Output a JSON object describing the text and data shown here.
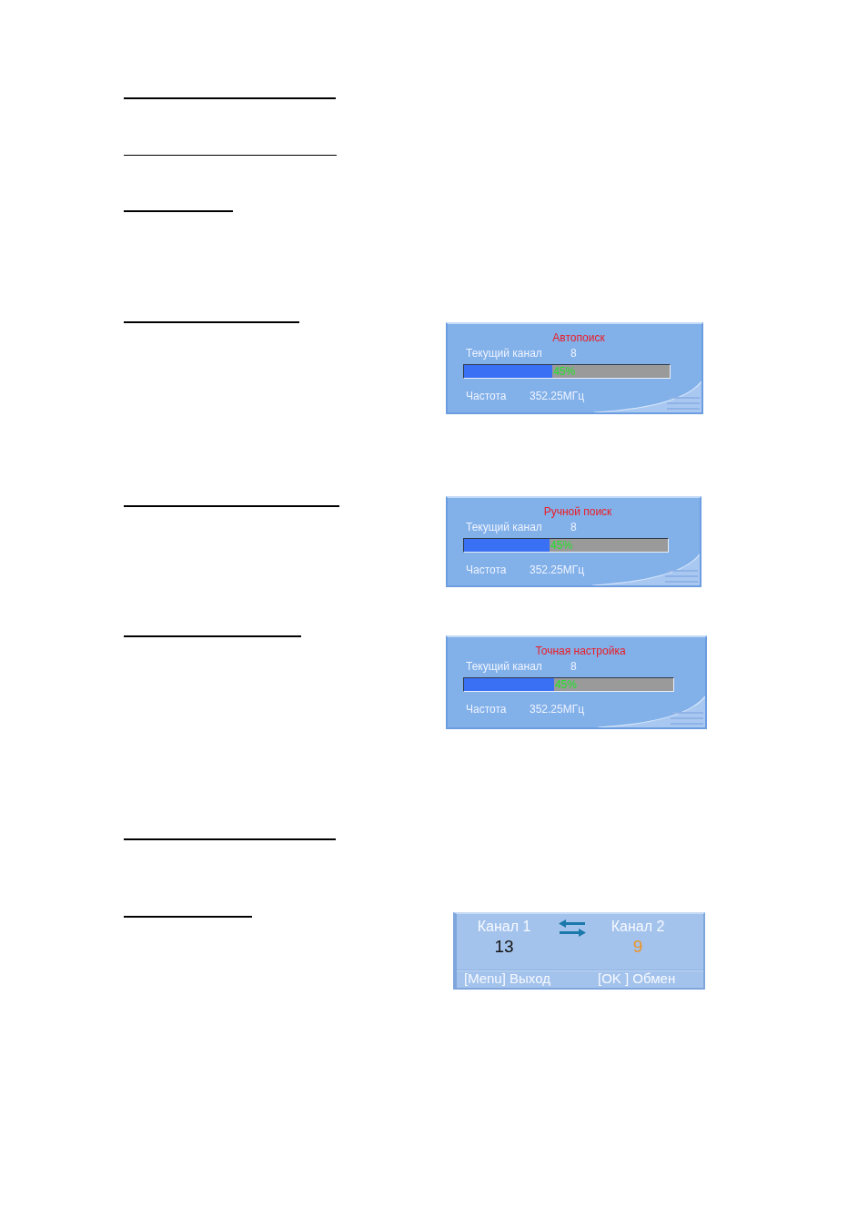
{
  "osd_screens": [
    {
      "kind": "search",
      "title": "Автопоиск",
      "channel_label": "Текущий канал",
      "channel": "8",
      "progress": {
        "level": 0.43,
        "reading": "45%"
      },
      "frequency_label": "Частота",
      "frequency": "352.25МГц"
    },
    {
      "kind": "search",
      "title": "Ручной поиск",
      "channel_label": "Текущий канал",
      "channel": "8",
      "progress": {
        "level": 0.42,
        "reading": "45%"
      },
      "frequency_label": "Частота",
      "frequency": "352.25МГц"
    },
    {
      "kind": "search",
      "title": "Точная настройка",
      "channel_label": "Текущий канал",
      "channel": "8",
      "progress": {
        "level": 0.43,
        "reading": "45%"
      },
      "frequency_label": "Частота",
      "frequency": "352.25МГц"
    },
    {
      "kind": "swap",
      "channels": [
        {
          "label": "Канал 1",
          "number": "13",
          "highlighted": false
        },
        {
          "label": "Канал 2",
          "number": "9",
          "highlighted": true
        }
      ],
      "hints": [
        "[Menu] Выход",
        "[OK ] Обмен"
      ]
    }
  ]
}
